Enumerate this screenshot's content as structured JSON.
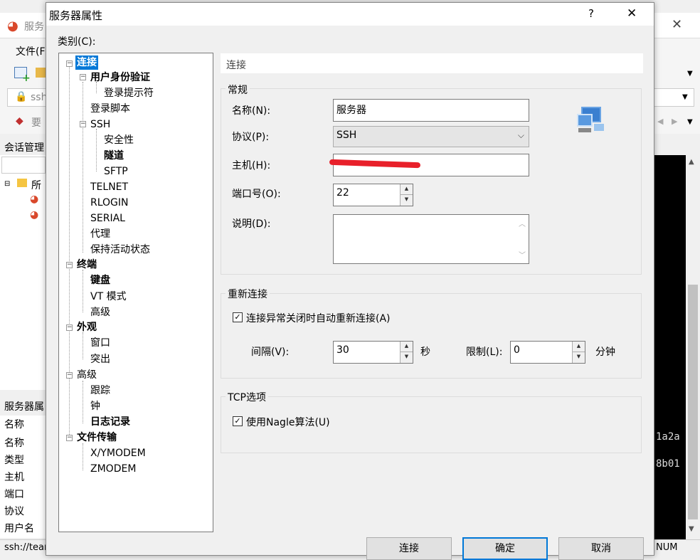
{
  "background_app": {
    "title": "服务",
    "menu_file": "文件(F",
    "addr_prefix": "ssh",
    "toolbar_item": "要",
    "session_panel_title": "会话管理",
    "tree_root": "所",
    "props_title": "服务器属",
    "props_rows": [
      "名称",
      "名称",
      "类型",
      "主机",
      "端口",
      "协议",
      "用户名"
    ],
    "status_left": "ssh://tean",
    "status_right": "NUM",
    "terminal_lines": [
      "1a2a",
      "8b01"
    ]
  },
  "dialog": {
    "title": "服务器属性",
    "help": "?",
    "close": "✕",
    "category_label": "类别(C):",
    "tree": [
      {
        "label": "连接",
        "level": 0,
        "bold": true,
        "selected": true,
        "expander": "−"
      },
      {
        "label": "用户身份验证",
        "level": 1,
        "bold": true,
        "expander": "−"
      },
      {
        "label": "登录提示符",
        "level": 2,
        "bold": false
      },
      {
        "label": "登录脚本",
        "level": 1,
        "bold": false
      },
      {
        "label": "SSH",
        "level": 1,
        "bold": false,
        "expander": "−"
      },
      {
        "label": "安全性",
        "level": 2,
        "bold": false
      },
      {
        "label": "隧道",
        "level": 2,
        "bold": true
      },
      {
        "label": "SFTP",
        "level": 2,
        "bold": false
      },
      {
        "label": "TELNET",
        "level": 1,
        "bold": false
      },
      {
        "label": "RLOGIN",
        "level": 1,
        "bold": false
      },
      {
        "label": "SERIAL",
        "level": 1,
        "bold": false
      },
      {
        "label": "代理",
        "level": 1,
        "bold": false
      },
      {
        "label": "保持活动状态",
        "level": 1,
        "bold": false
      },
      {
        "label": "终端",
        "level": 0,
        "bold": true,
        "expander": "−"
      },
      {
        "label": "键盘",
        "level": 1,
        "bold": true
      },
      {
        "label": "VT 模式",
        "level": 1,
        "bold": false
      },
      {
        "label": "高级",
        "level": 1,
        "bold": false
      },
      {
        "label": "外观",
        "level": 0,
        "bold": true,
        "expander": "−"
      },
      {
        "label": "窗口",
        "level": 1,
        "bold": false
      },
      {
        "label": "突出",
        "level": 1,
        "bold": false
      },
      {
        "label": "高级",
        "level": 0,
        "bold": false,
        "expander": "−"
      },
      {
        "label": "跟踪",
        "level": 1,
        "bold": false
      },
      {
        "label": "钟",
        "level": 1,
        "bold": false
      },
      {
        "label": "日志记录",
        "level": 1,
        "bold": true
      },
      {
        "label": "文件传输",
        "level": 0,
        "bold": true,
        "expander": "−"
      },
      {
        "label": "X/YMODEM",
        "level": 1,
        "bold": false
      },
      {
        "label": "ZMODEM",
        "level": 1,
        "bold": false
      }
    ],
    "panel_header": "连接",
    "general_group": "常规",
    "name_label": "名称(N):",
    "name_value": "服务器",
    "protocol_label": "协议(P):",
    "protocol_value": "SSH",
    "host_label": "主机(H):",
    "host_value": "",
    "port_label": "端口号(O):",
    "port_value": "22",
    "desc_label": "说明(D):",
    "desc_value": "",
    "reconnect_group": "重新连接",
    "reconnect_check": "连接异常关闭时自动重新连接(A)",
    "reconnect_checked": true,
    "interval_label": "间隔(V):",
    "interval_value": "30",
    "interval_unit": "秒",
    "limit_label": "限制(L):",
    "limit_value": "0",
    "limit_unit": "分钟",
    "tcp_group": "TCP选项",
    "nagle_check": "使用Nagle算法(U)",
    "nagle_checked": true,
    "btn_connect": "连接",
    "btn_ok": "确定",
    "btn_cancel": "取消"
  },
  "colors": {
    "selection": "#0078d7",
    "redaction": "#e8202a"
  }
}
